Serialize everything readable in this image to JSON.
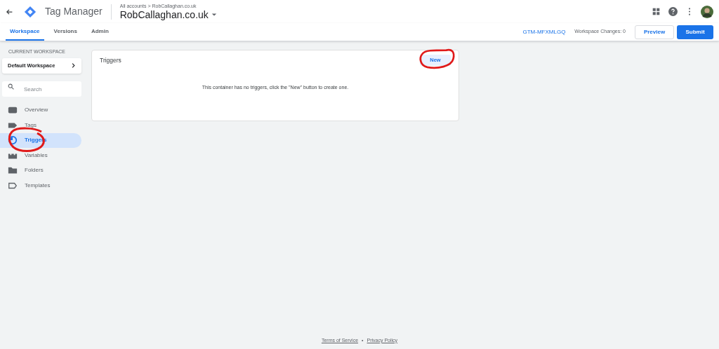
{
  "header": {
    "product": "Tag Manager",
    "breadcrumb": "All accounts > RobCallaghan.co.uk",
    "account": "RobCallaghan.co.uk"
  },
  "tabs": [
    {
      "label": "Workspace",
      "selected": true
    },
    {
      "label": "Versions",
      "selected": false
    },
    {
      "label": "Admin",
      "selected": false
    }
  ],
  "toolbar": {
    "container_id": "GTM-MFXMLGQ",
    "workspace_changes": "Workspace Changes: 0",
    "preview": "Preview",
    "submit": "Submit"
  },
  "sidebar": {
    "section_label": "CURRENT WORKSPACE",
    "workspace": "Default Workspace",
    "search": {
      "placeholder": "Search"
    },
    "items": [
      {
        "label": "Overview",
        "selected": false
      },
      {
        "label": "Tags",
        "selected": false
      },
      {
        "label": "Triggers",
        "selected": true
      },
      {
        "label": "Variables",
        "selected": false
      },
      {
        "label": "Folders",
        "selected": false
      },
      {
        "label": "Templates",
        "selected": false
      }
    ]
  },
  "card": {
    "title": "Triggers",
    "new_button": "New",
    "empty_message": "This container has no triggers, click the \"New\" button to create one."
  },
  "footer": {
    "links": [
      "Terms of Service",
      "Privacy Policy"
    ],
    "separator": "•"
  }
}
